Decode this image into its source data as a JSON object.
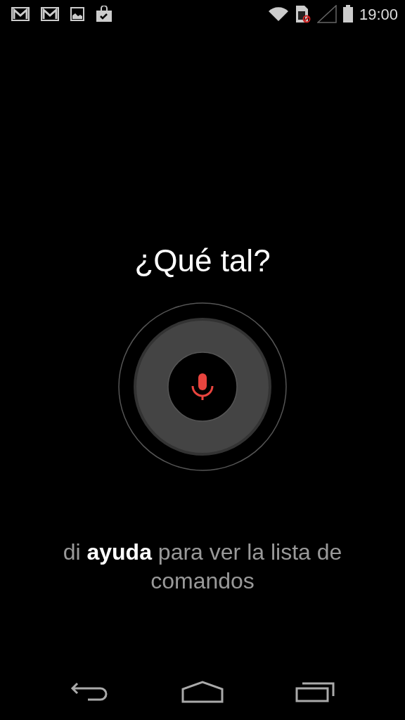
{
  "status_bar": {
    "time": "19:00"
  },
  "prompt": "¿Qué tal?",
  "hint": "di **ayuda** para ver la lista de comandos"
}
